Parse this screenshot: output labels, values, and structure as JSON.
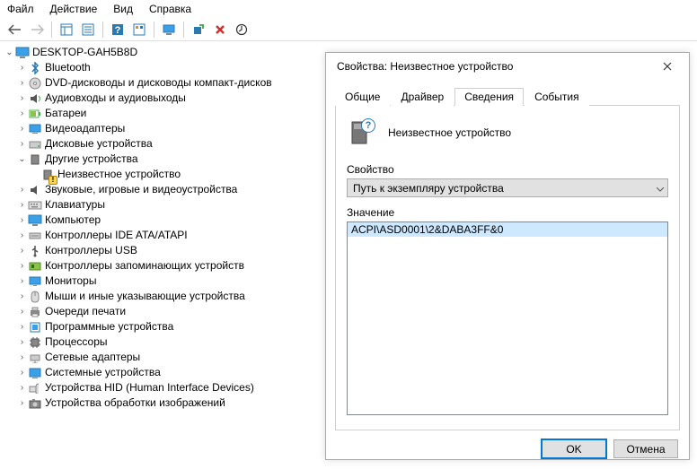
{
  "menu": {
    "file": "Файл",
    "action": "Действие",
    "view": "Вид",
    "help": "Справка"
  },
  "tree": {
    "root": "DESKTOP-GAH5B8D",
    "items": [
      "Bluetooth",
      "DVD-дисководы и дисководы компакт-дисков",
      "Аудиовходы и аудиовыходы",
      "Батареи",
      "Видеоадаптеры",
      "Дисковые устройства",
      "Другие устройства",
      "Звуковые, игровые и видеоустройства",
      "Клавиатуры",
      "Компьютер",
      "Контроллеры IDE ATA/ATAPI",
      "Контроллеры USB",
      "Контроллеры запоминающих устройств",
      "Мониторы",
      "Мыши и иные указывающие устройства",
      "Очереди печати",
      "Программные устройства",
      "Процессоры",
      "Сетевые адаптеры",
      "Системные устройства",
      "Устройства HID (Human Interface Devices)",
      "Устройства обработки изображений"
    ],
    "child_unknown": "Неизвестное устройство"
  },
  "dialog": {
    "title": "Свойства: Неизвестное устройство",
    "tabs": {
      "general": "Общие",
      "driver": "Драйвер",
      "details": "Сведения",
      "events": "События"
    },
    "device_name": "Неизвестное устройство",
    "property_label": "Свойство",
    "property_selected": "Путь к экземпляру устройства",
    "value_label": "Значение",
    "value": "ACPI\\ASD0001\\2&DABA3FF&0",
    "ok": "OK",
    "cancel": "Отмена"
  }
}
